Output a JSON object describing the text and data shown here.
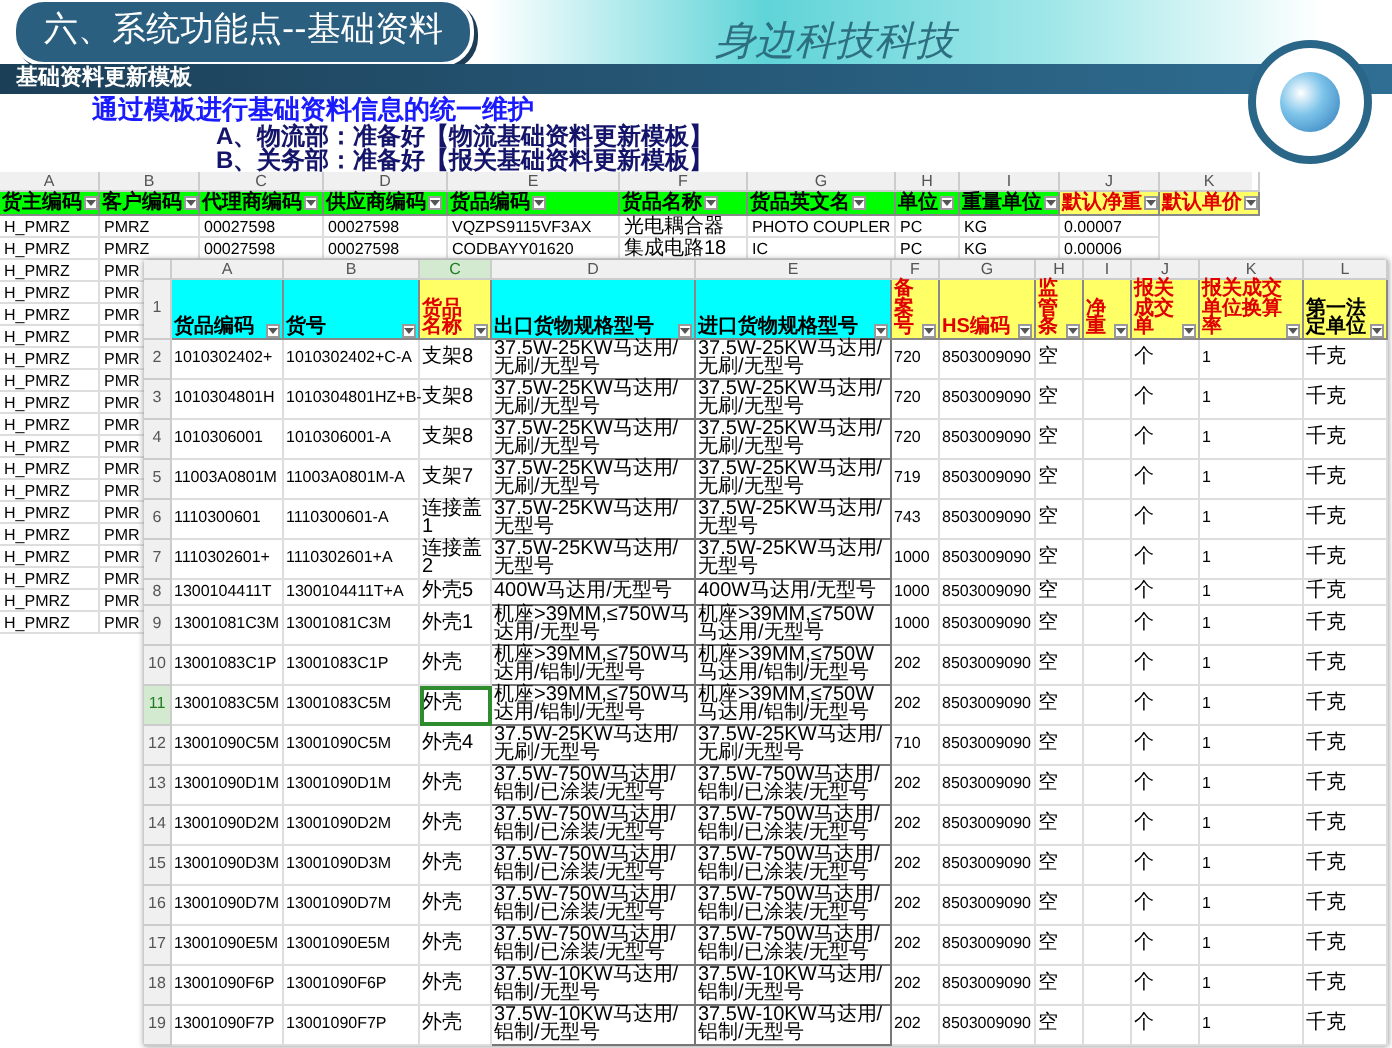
{
  "header": {
    "title": "六、系统功能点--基础资料",
    "brand": "身边科技科技",
    "subtitle": "基础资料更新模板"
  },
  "intro": "通过模板进行基础资料信息的统一维护",
  "bullets": [
    "A、物流部：准备好【物流基础资料更新模板】",
    "B、关务部：准备好【报关基础资料更新模板】"
  ],
  "back_sheet": {
    "column_letters": [
      "A",
      "B",
      "C",
      "D",
      "E",
      "F",
      "G",
      "H",
      "I",
      "J",
      "K"
    ],
    "columns": [
      {
        "label": "货主编码",
        "color": "#00ff00",
        "required": false
      },
      {
        "label": "客户编码",
        "color": "#00ff00",
        "required": false
      },
      {
        "label": "代理商编码",
        "color": "#00ff00",
        "required": false
      },
      {
        "label": "供应商编码",
        "color": "#00ff00",
        "required": false
      },
      {
        "label": "货品编码",
        "color": "#00ff00",
        "required": false
      },
      {
        "label": "货品名称",
        "color": "#00ff00",
        "required": false
      },
      {
        "label": "货品英文名",
        "color": "#00ff00",
        "required": false
      },
      {
        "label": "单位",
        "color": "#00ff00",
        "required": false
      },
      {
        "label": "重量单位",
        "color": "#00ff00",
        "required": false
      },
      {
        "label": "默认净重",
        "color": "#ffff66",
        "required": true
      },
      {
        "label": "默认单价",
        "color": "#ffff66",
        "required": true
      }
    ],
    "rows": [
      [
        "H_PMRZ",
        "PMRZ",
        "00027598",
        "00027598",
        "VQZPS9115VF3AX",
        "光电耦合器",
        "PHOTO COUPLER",
        "PC",
        "KG",
        "0.00007"
      ],
      [
        "H_PMRZ",
        "PMRZ",
        "00027598",
        "00027598",
        "CODBAYY01620",
        "集成电路18",
        "IC",
        "PC",
        "KG",
        "0.00006"
      ],
      [
        "H_PMRZ",
        "PMR"
      ],
      [
        "H_PMRZ",
        "PMR"
      ],
      [
        "H_PMRZ",
        "PMR"
      ],
      [
        "H_PMRZ",
        "PMR"
      ],
      [
        "H_PMRZ",
        "PMR"
      ],
      [
        "H_PMRZ",
        "PMR"
      ],
      [
        "H_PMRZ",
        "PMR"
      ],
      [
        "H_PMRZ",
        "PMR"
      ],
      [
        "H_PMRZ",
        "PMR"
      ],
      [
        "H_PMRZ",
        "PMR"
      ],
      [
        "H_PMRZ",
        "PMR"
      ],
      [
        "H_PMRZ",
        "PMR"
      ],
      [
        "H_PMRZ",
        "PMR"
      ],
      [
        "H_PMRZ",
        "PMR"
      ],
      [
        "H_PMRZ",
        "PMR"
      ],
      [
        "H_PMRZ",
        "PMR"
      ],
      [
        "H_PMRZ",
        "PMR"
      ]
    ]
  },
  "front_sheet": {
    "column_letters": [
      {
        "label": "A",
        "selected": false
      },
      {
        "label": "B",
        "selected": false
      },
      {
        "label": "C",
        "selected": true
      },
      {
        "label": "D",
        "selected": false
      },
      {
        "label": "E",
        "selected": false
      },
      {
        "label": "F",
        "selected": false
      },
      {
        "label": "G",
        "selected": false
      },
      {
        "label": "H",
        "selected": false
      },
      {
        "label": "I",
        "selected": false
      },
      {
        "label": "J",
        "selected": false
      },
      {
        "label": "K",
        "selected": false
      },
      {
        "label": "L",
        "selected": false
      }
    ],
    "header_row_number": "1",
    "columns": [
      {
        "label": "货品编码",
        "color": "#00ffff",
        "required": false
      },
      {
        "label": "货号",
        "color": "#00ffff",
        "required": false
      },
      {
        "label": "货品名称",
        "color": "#ffff66",
        "required": true
      },
      {
        "label": "出口货物规格型号",
        "color": "#00ffff",
        "required": false
      },
      {
        "label": "进口货物规格型号",
        "color": "#00ffff",
        "required": false
      },
      {
        "label": "备案号",
        "color": "#ffff66",
        "required": true
      },
      {
        "label": "HS编码",
        "color": "#ffff66",
        "required": true
      },
      {
        "label": "监管条",
        "color": "#ffff66",
        "required": true
      },
      {
        "label": "净重",
        "color": "#ffff66",
        "required": true
      },
      {
        "label": "报关成交单",
        "color": "#ffff66",
        "required": true
      },
      {
        "label": "报关成交单位换算率",
        "color": "#ffff66",
        "required": true
      },
      {
        "label": "第一法定单位",
        "color": "#ffff66",
        "required": false
      }
    ],
    "rows": [
      {
        "number": "2",
        "selected": false,
        "cells": [
          "1010302402+",
          "1010302402+C-A",
          "支架8",
          "37.5W-25KW马达用/无刷/无型号",
          "37.5W-25KW马达用/无刷/无型号",
          "720",
          "8503009090",
          "空",
          "",
          "个",
          "1",
          "千克"
        ]
      },
      {
        "number": "3",
        "selected": false,
        "cells": [
          "1010304801H",
          "1010304801HZ+B-",
          "支架8",
          "37.5W-25KW马达用/无刷/无型号",
          "37.5W-25KW马达用/无刷/无型号",
          "720",
          "8503009090",
          "空",
          "",
          "个",
          "1",
          "千克"
        ]
      },
      {
        "number": "4",
        "selected": false,
        "cells": [
          "1010306001",
          "1010306001-A",
          "支架8",
          "37.5W-25KW马达用/无刷/无型号",
          "37.5W-25KW马达用/无刷/无型号",
          "720",
          "8503009090",
          "空",
          "",
          "个",
          "1",
          "千克"
        ]
      },
      {
        "number": "5",
        "selected": false,
        "cells": [
          "11003A0801M",
          "11003A0801M-A",
          "支架7",
          "37.5W-25KW马达用/无刷/无型号",
          "37.5W-25KW马达用/无刷/无型号",
          "719",
          "8503009090",
          "空",
          "",
          "个",
          "1",
          "千克"
        ]
      },
      {
        "number": "6",
        "selected": false,
        "cells": [
          "1110300601",
          "1110300601-A",
          "连接盖1",
          "37.5W-25KW马达用/无型号",
          "37.5W-25KW马达用/无型号",
          "743",
          "8503009090",
          "空",
          "",
          "个",
          "1",
          "千克"
        ]
      },
      {
        "number": "7",
        "selected": false,
        "cells": [
          "1110302601+",
          "1110302601+A",
          "连接盖2",
          "37.5W-25KW马达用/无型号",
          "37.5W-25KW马达用/无型号",
          "1000",
          "8503009090",
          "空",
          "",
          "个",
          "1",
          "千克"
        ]
      },
      {
        "number": "8",
        "selected": false,
        "cells": [
          "1300104411T",
          "1300104411T+A",
          "外壳5",
          "400W马达用/无型号",
          "400W马达用/无型号",
          "1000",
          "8503009090",
          "空",
          "",
          "个",
          "1",
          "千克"
        ]
      },
      {
        "number": "9",
        "selected": false,
        "cells": [
          "13001081C3M",
          "13001081C3M",
          "外壳1",
          "机座>39MM,≤750W马达用/无型号",
          "机座>39MM,≤750W马达用/无型号",
          "1000",
          "8503009090",
          "空",
          "",
          "个",
          "1",
          "千克"
        ]
      },
      {
        "number": "10",
        "selected": false,
        "cells": [
          "13001083C1P",
          "13001083C1P",
          "外壳",
          "机座>39MM,≤750W马达用/铝制/无型号",
          "机座>39MM,≤750W马达用/铝制/无型号",
          "202",
          "8503009090",
          "空",
          "",
          "个",
          "1",
          "千克"
        ]
      },
      {
        "number": "11",
        "selected": true,
        "cells": [
          "13001083C5M",
          "13001083C5M",
          "外壳",
          "机座>39MM,≤750W马达用/铝制/无型号",
          "机座>39MM,≤750W马达用/铝制/无型号",
          "202",
          "8503009090",
          "空",
          "",
          "个",
          "1",
          "千克"
        ]
      },
      {
        "number": "12",
        "selected": false,
        "cells": [
          "13001090C5M",
          "13001090C5M",
          "外壳4",
          "37.5W-25KW马达用/无刷/无型号",
          "37.5W-25KW马达用/无刷/无型号",
          "710",
          "8503009090",
          "空",
          "",
          "个",
          "1",
          "千克"
        ]
      },
      {
        "number": "13",
        "selected": false,
        "cells": [
          "13001090D1M",
          "13001090D1M",
          "外壳",
          "37.5W-750W马达用/铝制/已涂装/无型号",
          "37.5W-750W马达用/铝制/已涂装/无型号",
          "202",
          "8503009090",
          "空",
          "",
          "个",
          "1",
          "千克"
        ]
      },
      {
        "number": "14",
        "selected": false,
        "cells": [
          "13001090D2M",
          "13001090D2M",
          "外壳",
          "37.5W-750W马达用/铝制/已涂装/无型号",
          "37.5W-750W马达用/铝制/已涂装/无型号",
          "202",
          "8503009090",
          "空",
          "",
          "个",
          "1",
          "千克"
        ]
      },
      {
        "number": "15",
        "selected": false,
        "cells": [
          "13001090D3M",
          "13001090D3M",
          "外壳",
          "37.5W-750W马达用/铝制/已涂装/无型号",
          "37.5W-750W马达用/铝制/已涂装/无型号",
          "202",
          "8503009090",
          "空",
          "",
          "个",
          "1",
          "千克"
        ]
      },
      {
        "number": "16",
        "selected": false,
        "cells": [
          "13001090D7M",
          "13001090D7M",
          "外壳",
          "37.5W-750W马达用/铝制/已涂装/无型号",
          "37.5W-750W马达用/铝制/已涂装/无型号",
          "202",
          "8503009090",
          "空",
          "",
          "个",
          "1",
          "千克"
        ]
      },
      {
        "number": "17",
        "selected": false,
        "cells": [
          "13001090E5M",
          "13001090E5M",
          "外壳",
          "37.5W-750W马达用/铝制/已涂装/无型号",
          "37.5W-750W马达用/铝制/已涂装/无型号",
          "202",
          "8503009090",
          "空",
          "",
          "个",
          "1",
          "千克"
        ]
      },
      {
        "number": "18",
        "selected": false,
        "cells": [
          "13001090F6P",
          "13001090F6P",
          "外壳",
          "37.5W-10KW马达用/铝制/无型号",
          "37.5W-10KW马达用/铝制/无型号",
          "202",
          "8503009090",
          "空",
          "",
          "个",
          "1",
          "千克"
        ]
      },
      {
        "number": "19",
        "selected": false,
        "cells": [
          "13001090F7P",
          "13001090F7P",
          "外壳",
          "37.5W-10KW马达用/铝制/无型号",
          "37.5W-10KW马达用/铝制/无型号",
          "202",
          "8503009090",
          "空",
          "",
          "个",
          "1",
          "千克"
        ]
      }
    ]
  }
}
